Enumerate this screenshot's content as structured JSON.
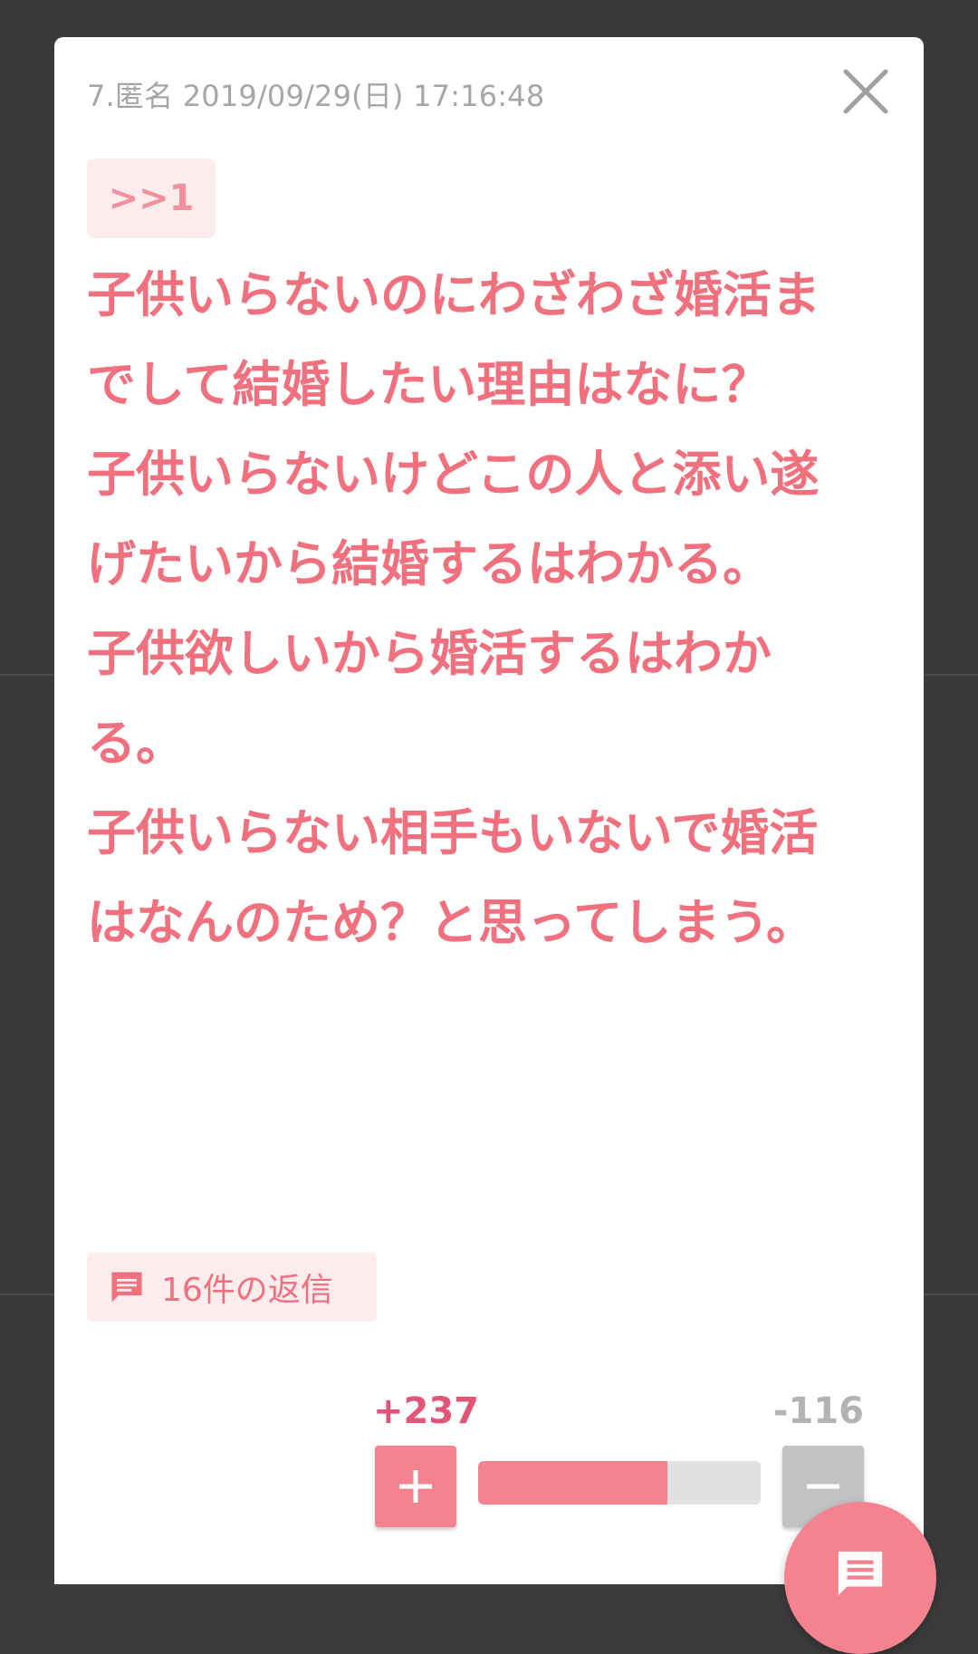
{
  "post": {
    "meta": "7.匿名 2019/09/29(日) 17:16:48",
    "anchor": ">>1",
    "body": "子供いらないのにわざわざ婚活までして結婚したい理由はなに？\n子供いらないけどこの人と添い遂げたいから結婚するはわかる。\n子供欲しいから婚活するはわかる。\n子供いらない相手もいないで婚活はなんのため？と思ってしまう。"
  },
  "replies": {
    "label": "16件の返信"
  },
  "votes": {
    "plus_label": "+237",
    "minus_label": "-116",
    "plus": 237,
    "minus": 116,
    "plus_button": "+",
    "minus_button": "−"
  },
  "colors": {
    "accent": "#f4838f",
    "text_pink": "#f0707e",
    "plus_count": "#e35577",
    "minus_gray": "#c2c2c2"
  },
  "icons": {
    "close": "close-icon",
    "reply": "comment-icon",
    "fab": "comment-icon"
  }
}
